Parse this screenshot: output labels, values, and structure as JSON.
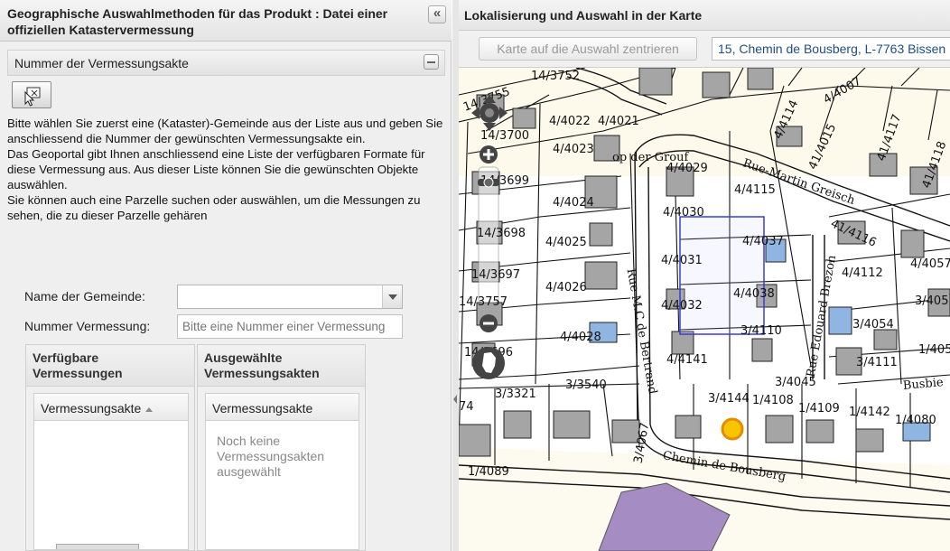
{
  "left_panel": {
    "title": "Geographische Auswahlmethoden für das Produkt : Datei einer offiziellen Katastervermessung",
    "collapse_symbol": "«",
    "section_title": "Nummer der Vermessungsakte",
    "tool_icon": "select-on-map-icon",
    "instructions": [
      "Bitte wählen Sie zuerst eine (Kataster)-Gemeinde aus der Liste aus und geben Sie anschliessend die Nummer der gewünschten Vermessungsakte ein.",
      "Das Geoportal gibt Ihnen anschliessend eine Liste der verfügbaren Formate für diese Vermessung aus. Aus dieser Liste können Sie die gewünschten Objekte auswählen.",
      "Sie können auch eine Parzelle suchen oder auswählen, um die Messungen zu sehen, die zu dieser Parzelle gehären"
    ],
    "form": {
      "gemeinde_label": "Name der Gemeinde:",
      "gemeinde_value": "",
      "nummer_label": "Nummer Vermessung:",
      "nummer_placeholder": "Bitte eine Nummer einer Vermessung"
    },
    "available_grid": {
      "title": "Verfügbare Vermessungen",
      "column": "Vermessungsakte"
    },
    "selected_grid": {
      "title": "Ausgewählte Vermessungsakten",
      "column": "Vermessungsakte",
      "empty_text": "Noch keine Vermessungsakten ausgewählt"
    }
  },
  "right_panel": {
    "title": "Lokalisierung und Auswahl in der Karte",
    "center_button": "Karte auf die Auswahl zentrieren",
    "address": "15, Chemin de Bousberg, L-7763 Bissen"
  },
  "map": {
    "streets": [
      "op der Grouf",
      "Rue-Martin Greisch",
      "Rue M.C de Bertrand",
      "Rue Edouard Brezoh",
      "Chemin de Bousberg",
      "Busbie"
    ],
    "parcels": [
      "14/3752",
      "14/3755",
      "14/3700",
      "4/4022",
      "4/4021",
      "4/4023",
      "14/3699",
      "4/4024",
      "14/3698",
      "4/4025",
      "14/3697",
      "4/4026",
      "14/3757",
      "4/4028",
      "14/3696",
      "4/4141",
      "3/3321",
      "3/3540",
      "74",
      "3/4067",
      "1/4089",
      "4/4029",
      "4/4115",
      "4/4030",
      "4/4037",
      "4/4031",
      "4/4038",
      "4/4032",
      "3/4110",
      "3/4144",
      "1/4108",
      "3/4045",
      "1/4109",
      "1/4142",
      "1/4080",
      "4/4114",
      "4/4007",
      "41/4015",
      "41/4117",
      "41/4118",
      "41/4116",
      "4/4112",
      "4/4057",
      "3/4054",
      "3/405",
      "3/4111",
      "1/405"
    ],
    "controls": {
      "pan": "pan-icon",
      "zoom_in": "+",
      "zoom_out": "−",
      "world": "world-icon"
    },
    "colors": {
      "building": "#a5a5a5",
      "selected_building": "#8fb6e2",
      "selection_box": "#3b3bd0",
      "marker": "#f7c600",
      "public_area": "#a58cc2",
      "land": "#fdf8e8"
    }
  }
}
